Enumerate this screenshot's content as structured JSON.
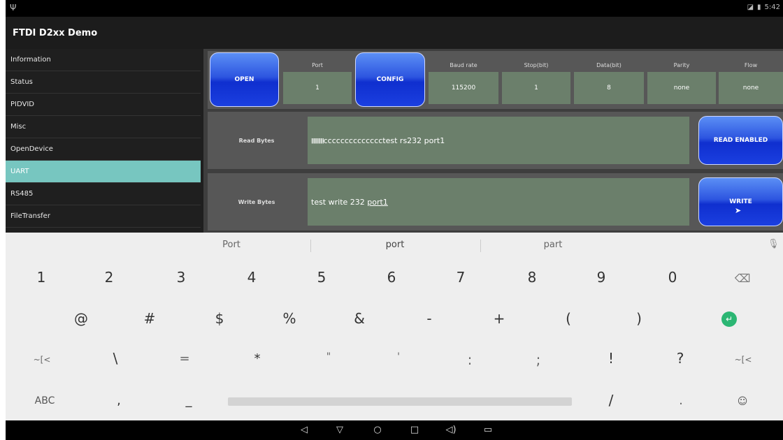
{
  "status": {
    "left_icon": "usb-icon",
    "time": "5:42"
  },
  "app": {
    "title": "FTDI D2xx Demo"
  },
  "sidebar": {
    "items": [
      {
        "label": "Information"
      },
      {
        "label": "Status"
      },
      {
        "label": "PIDVID"
      },
      {
        "label": "Misc"
      },
      {
        "label": "OpenDevice"
      },
      {
        "label": "UART",
        "active": true
      },
      {
        "label": "RS485"
      },
      {
        "label": "FileTransfer"
      }
    ]
  },
  "uart": {
    "open_label": "OPEN",
    "config_label": "CONFIG",
    "port_label": "Port",
    "port_value": "1",
    "baud_label": "Baud rate",
    "baud_value": "115200",
    "stop_label": "Stop(bit)",
    "stop_value": "1",
    "data_label": "Data(bit)",
    "data_value": "8",
    "parity_label": "Parity",
    "parity_value": "none",
    "flow_label": "Flow",
    "flow_value": "none",
    "read_label": "Read Bytes",
    "read_garble": "ǁǁǁǁǁǁ",
    "read_value": "cccccccccccccctest rs232 port1",
    "read_button": "READ ENABLED",
    "write_label": "Write Bytes",
    "write_prefix": "test write 232 ",
    "write_underlined": "port1",
    "write_button": "WRITE"
  },
  "keyboard": {
    "suggestions": [
      "Port",
      "port",
      "part"
    ],
    "row1": [
      "1",
      "2",
      "3",
      "4",
      "5",
      "6",
      "7",
      "8",
      "9",
      "0"
    ],
    "row2": [
      "@",
      "#",
      "$",
      "%",
      "&",
      "-",
      "+",
      "(",
      ")"
    ],
    "row3": [
      "~[<",
      "\\",
      "=",
      "*",
      "\"",
      "'",
      ":",
      ";",
      "!",
      "?",
      "~[<"
    ],
    "abc_label": "ABC",
    "row4": [
      ",",
      "_",
      "/",
      "."
    ]
  }
}
